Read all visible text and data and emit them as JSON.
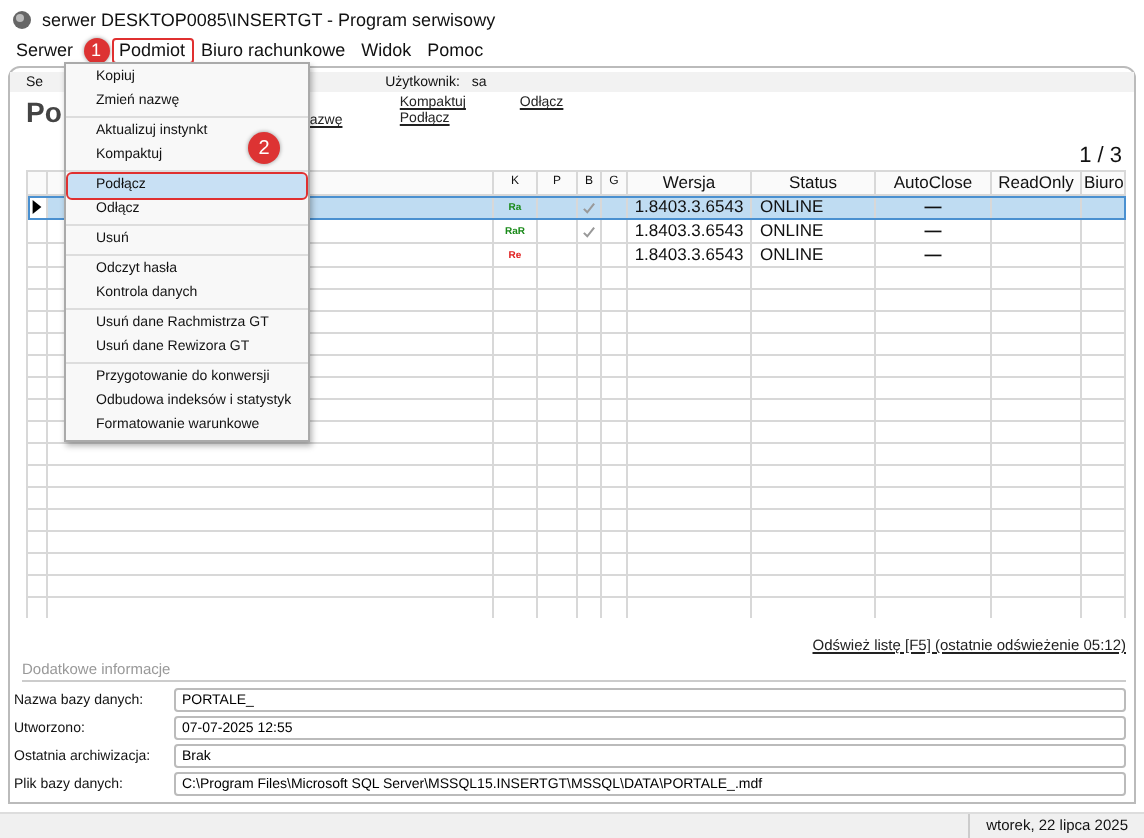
{
  "window": {
    "title": "serwer DESKTOP0085\\INSERTGT - Program serwisowy"
  },
  "menu_bar": [
    {
      "label": "Serwer",
      "selected": false
    },
    {
      "label": "Podmiot",
      "selected": true
    },
    {
      "label": "Biuro rachunkowe",
      "selected": false
    },
    {
      "label": "Widok",
      "selected": false
    },
    {
      "label": "Pomoc",
      "selected": false
    }
  ],
  "step_badges": [
    "1",
    "2"
  ],
  "dropdown": [
    [
      {
        "label": "Kopiuj",
        "selected": false
      },
      {
        "label": "Zmień nazwę",
        "selected": false
      }
    ],
    [
      {
        "label": "Aktualizuj instynkt",
        "selected": false
      },
      {
        "label": "Kompaktuj",
        "selected": false
      }
    ],
    [
      {
        "label": "Podłącz",
        "selected": true
      },
      {
        "label": "Odłącz",
        "selected": false
      }
    ],
    [
      {
        "label": "Usuń",
        "selected": false
      }
    ],
    [
      {
        "label": "Odczyt hasła",
        "selected": false
      },
      {
        "label": "Kontrola danych",
        "selected": false
      }
    ],
    [
      {
        "label": "Usuń dane Rachmistrza GT",
        "selected": false
      },
      {
        "label": "Usuń dane Rewizora GT",
        "selected": false
      }
    ],
    [
      {
        "label": "Przygotowanie do konwersji",
        "selected": false
      },
      {
        "label": "Odbudowa indeksów i statystyk",
        "selected": false
      },
      {
        "label": "Formatowanie warunkowe",
        "selected": false
      }
    ]
  ],
  "panel": {
    "tab_label": "Se",
    "user_label": "Użytkownik:",
    "user": "sa",
    "title": "Po",
    "links": [
      [
        "azwę"
      ],
      [
        "Kompaktuj",
        "Podłącz"
      ],
      [
        "Odłącz"
      ]
    ],
    "counter": "1 / 3"
  },
  "table": {
    "columns": [
      "K",
      "P",
      "B",
      "G",
      "Wersja",
      "Status",
      "AutoClose",
      "ReadOnly",
      "Biuro"
    ],
    "rows": [
      {
        "selected": true,
        "k": "Ra",
        "color": "#1a8a1a",
        "b_checked": true,
        "version": "1.8403.3.6543",
        "status": "ONLINE",
        "autoclose": "—"
      },
      {
        "selected": false,
        "k": "RaR",
        "color": "#1a8a1a",
        "b_checked": true,
        "version": "1.8403.3.6543",
        "status": "ONLINE",
        "autoclose": "—"
      },
      {
        "selected": false,
        "k": "Re",
        "color": "#e02020",
        "b_checked": false,
        "version": "1.8403.3.6543",
        "status": "ONLINE",
        "autoclose": "—"
      }
    ]
  },
  "refresh_link": "Odśwież listę [F5] (ostatnie odświeżenie 05:12)",
  "details": {
    "title": "Dodatkowe informacje",
    "fields": [
      {
        "label": "Nazwa bazy danych:",
        "value": "PORTALE_"
      },
      {
        "label": "Utworzono:",
        "value": "07-07-2025 12:55"
      },
      {
        "label": "Ostatnia archiwizacja:",
        "value": "Brak"
      },
      {
        "label": "Plik bazy danych:",
        "value": "C:\\Program Files\\Microsoft SQL Server\\MSSQL15.INSERTGT\\MSSQL\\DATA\\PORTALE_.mdf"
      }
    ]
  },
  "status_bar": {
    "date": "wtorek, 22 lipca 2025"
  }
}
